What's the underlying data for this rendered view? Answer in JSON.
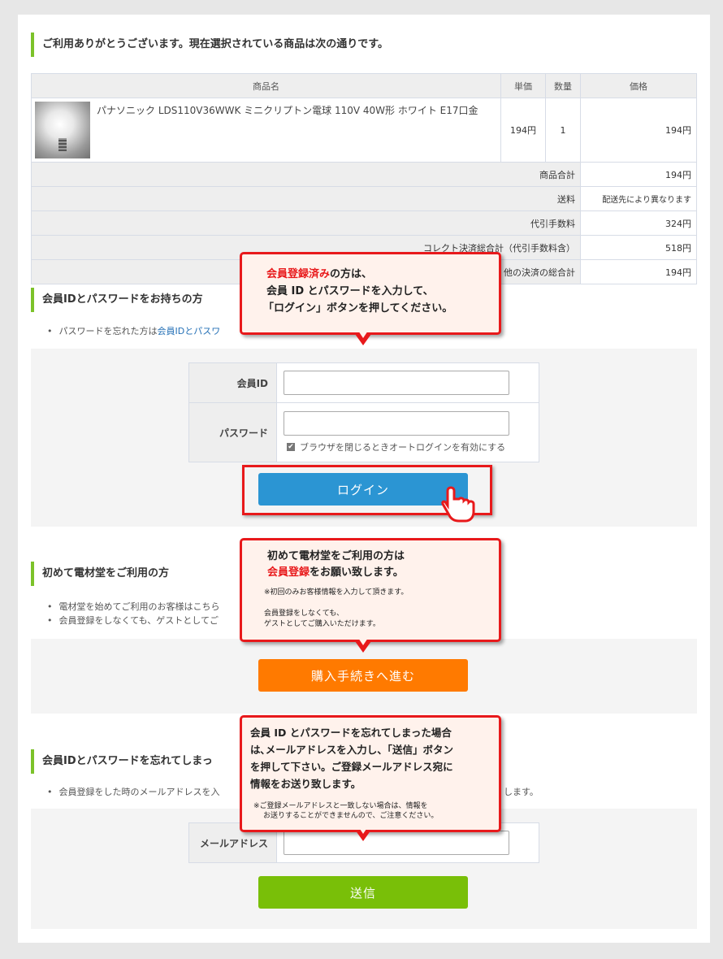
{
  "order": {
    "title": "ご利用ありがとうございます。現在選択されている商品は次の通りです。",
    "headers": {
      "name": "商品名",
      "unit_price": "単価",
      "qty": "数量",
      "price": "価格"
    },
    "item": {
      "name": "パナソニック LDS110V36WWK ミニクリプトン電球 110V 40W形 ホワイト E17口金",
      "unit_price": "194円",
      "qty": "1",
      "price": "194円"
    },
    "summary": [
      {
        "label": "商品合計",
        "value": "194円"
      },
      {
        "label": "送料",
        "value": "配送先により異なります"
      },
      {
        "label": "代引手数料",
        "value": "324円"
      },
      {
        "label": "コレクト決済総合計（代引手数料含）",
        "value": "518円"
      },
      {
        "label": "他の決済の総合計",
        "value": "194円"
      }
    ]
  },
  "login": {
    "title": "会員IDとパスワードをお持ちの方",
    "bullet_prefix": "パスワードを忘れた方は",
    "bullet_link": "会員IDとパスワ",
    "id_label": "会員ID",
    "password_label": "パスワード",
    "autologin_label": "ブラウザを閉じるときオートログインを有効にする",
    "button": "ログイン"
  },
  "newuser": {
    "title": "初めて電材堂をご利用の方",
    "bullet1": "電材堂を始めてご利用のお客様はこちら",
    "bullet2": "会員登録をしなくても、ゲストとしてご",
    "button": "購入手続きへ進む"
  },
  "forgot": {
    "title": "会員IDとパスワードを忘れてしまっ",
    "bullet": "会員登録をした時のメールアドレスを入",
    "bullet_tail": "します。",
    "email_label": "メールアドレス",
    "button": "送信"
  },
  "callout1": {
    "red": "会員登録済み",
    "line1_rest": "の方は、",
    "line2": "会員 ID とパスワードを入力して、",
    "line3": "「ログイン」ボタンを押してください。"
  },
  "callout2": {
    "line1": "初めて電材堂をご利用の方は",
    "red": "会員登録",
    "line2_rest": "をお願い致します。",
    "note1": "※初回のみお客様情報を入力して頂きます。",
    "note2a": "会員登録をしなくても、",
    "note2b": "ゲストとしてご購入いただけます。"
  },
  "callout3": {
    "line1": "会員 ID とパスワードを忘れてしまった場合",
    "line2": "は､メールアドレスを入力し、「送信」ボタン",
    "line3": "を押して下さい。ご登録メールアドレス宛に",
    "line4": "情報をお送り致します。",
    "note1": "※ご登録メールアドレスと一致しない場合は、情報を",
    "note2": "お送りすることができませんので、ご注意ください。"
  },
  "colors": {
    "accent_green": "#7cc22a",
    "login_blue": "#2b95d3",
    "orange": "#ff7a00",
    "send_green": "#79bf08",
    "callout_red": "#e8191b"
  }
}
